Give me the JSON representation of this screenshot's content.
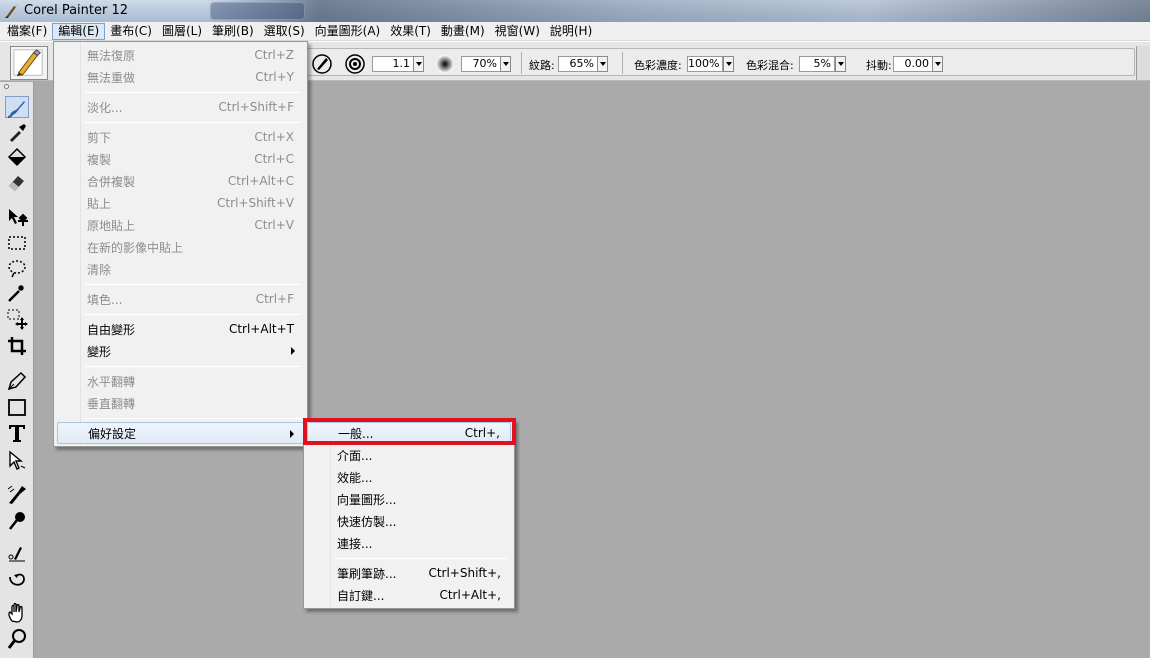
{
  "window": {
    "title": "Corel Painter 12"
  },
  "menubar": {
    "items": [
      {
        "label": "檔案(F)"
      },
      {
        "label": "編輯(E)"
      },
      {
        "label": "畫布(C)"
      },
      {
        "label": "圖層(L)"
      },
      {
        "label": "筆刷(B)"
      },
      {
        "label": "選取(S)"
      },
      {
        "label": "向量圖形(A)"
      },
      {
        "label": "效果(T)"
      },
      {
        "label": "動畫(M)"
      },
      {
        "label": "視窗(W)"
      },
      {
        "label": "說明(H)"
      }
    ]
  },
  "propbar": {
    "size": "1.1",
    "opacity": "70%",
    "grain_label": "紋路:",
    "grain": "65%",
    "resat_label": "色彩濃度:",
    "resat": "100%",
    "bleed_label": "色彩混合:",
    "bleed": "5%",
    "jitter_label": "抖動:",
    "jitter": "0.00"
  },
  "edit_menu": {
    "items": [
      {
        "label": "無法復原",
        "shortcut": "Ctrl+Z"
      },
      {
        "label": "無法重做",
        "shortcut": "Ctrl+Y"
      },
      {
        "label": "淡化...",
        "shortcut": "Ctrl+Shift+F"
      },
      {
        "label": "剪下",
        "shortcut": "Ctrl+X"
      },
      {
        "label": "複製",
        "shortcut": "Ctrl+C"
      },
      {
        "label": "合併複製",
        "shortcut": "Ctrl+Alt+C"
      },
      {
        "label": "貼上",
        "shortcut": "Ctrl+Shift+V"
      },
      {
        "label": "原地貼上",
        "shortcut": "Ctrl+V"
      },
      {
        "label": "在新的影像中貼上",
        "shortcut": ""
      },
      {
        "label": "清除",
        "shortcut": ""
      },
      {
        "label": "填色...",
        "shortcut": "Ctrl+F"
      },
      {
        "label": "自由變形",
        "shortcut": "Ctrl+Alt+T"
      },
      {
        "label": "變形",
        "shortcut": ""
      },
      {
        "label": "水平翻轉",
        "shortcut": ""
      },
      {
        "label": "垂直翻轉",
        "shortcut": ""
      },
      {
        "label": "偏好設定",
        "shortcut": ""
      }
    ]
  },
  "prefs_menu": {
    "items": [
      {
        "label": "一般...",
        "shortcut": "Ctrl+,"
      },
      {
        "label": "介面...",
        "shortcut": ""
      },
      {
        "label": "效能...",
        "shortcut": ""
      },
      {
        "label": "向量圖形...",
        "shortcut": ""
      },
      {
        "label": "快速仿製...",
        "shortcut": ""
      },
      {
        "label": "連接...",
        "shortcut": ""
      },
      {
        "label": "筆刷筆跡...",
        "shortcut": "Ctrl+Shift+,"
      },
      {
        "label": "自訂鍵...",
        "shortcut": "Ctrl+Alt+,"
      }
    ]
  },
  "colors": {
    "highlight": "#e0101f",
    "workspace": "#aaaaaa"
  }
}
